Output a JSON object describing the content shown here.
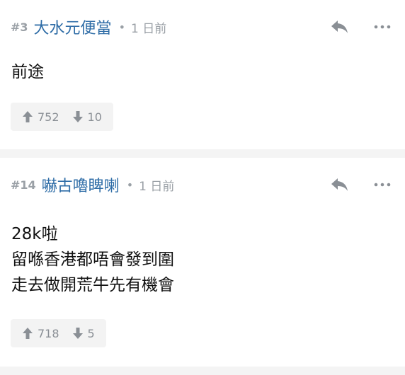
{
  "posts": [
    {
      "floor": "#3",
      "username": "大水元便當",
      "dot": "•",
      "time": "1 日前",
      "content_lines": [
        "前途"
      ],
      "upvotes": "752",
      "downvotes": "10"
    },
    {
      "floor": "#14",
      "username": "嚇古嚕睥喇",
      "dot": "•",
      "time": "1 日前",
      "content_lines": [
        "28k啦",
        "留喺香港都唔會發到圍",
        "走去做開荒牛先有機會"
      ],
      "upvotes": "718",
      "downvotes": "5"
    }
  ],
  "colors": {
    "username": "#2f6da7",
    "meta": "#9aa0a6",
    "vote_bg": "#f3f3f3",
    "separator": "#f4f4f4"
  },
  "icons": [
    "reply-icon",
    "more-icon",
    "upvote-icon",
    "downvote-icon"
  ]
}
